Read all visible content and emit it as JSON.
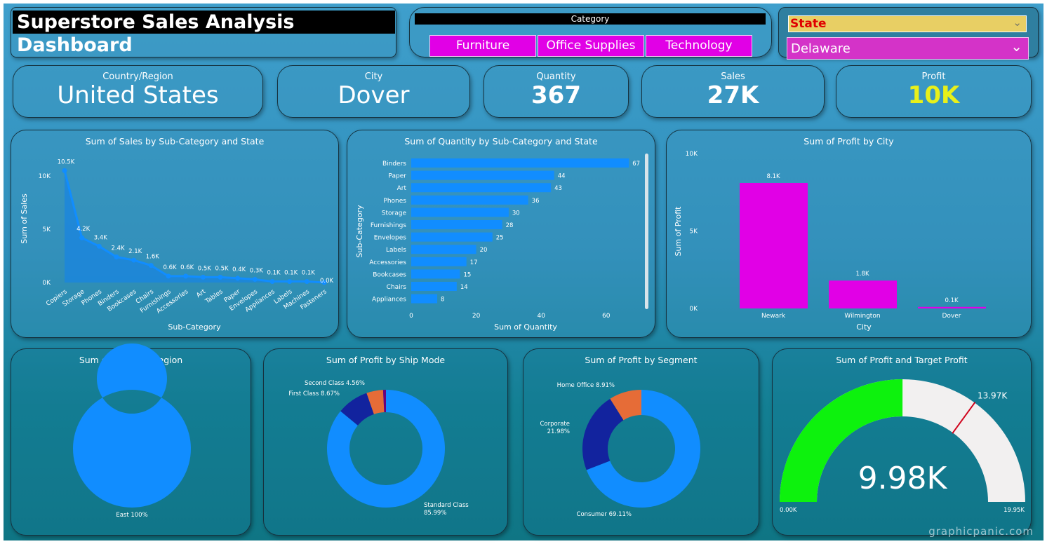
{
  "header": {
    "title": "Superstore Sales Analysis Dashboard"
  },
  "category_slicer": {
    "label": "Category",
    "options": [
      "Furniture",
      "Office Supplies",
      "Technology"
    ]
  },
  "state_slicer": {
    "label": "State",
    "selected": "Delaware"
  },
  "kpis": [
    {
      "label": "Country/Region",
      "value": "United States"
    },
    {
      "label": "City",
      "value": "Dover"
    },
    {
      "label": "Quantity",
      "value": "367"
    },
    {
      "label": "Sales",
      "value": "27K"
    },
    {
      "label": "Profit",
      "value": "10K",
      "color": "#e8f01a"
    }
  ],
  "watermark": "graphicpanic.com",
  "colors": {
    "bar_blue": "#118dff",
    "magenta": "#e100e6",
    "navy": "#12239e",
    "orange": "#e66c37",
    "purple": "#6b007b",
    "gauge_green": "#0df20d",
    "gauge_bg": "#f2f0f0",
    "target": "#d0021b"
  },
  "chart_data": [
    {
      "type": "area",
      "title": "Sum of Sales by Sub-Category and State",
      "xlabel": "Sub-Category",
      "ylabel": "Sum of Sales",
      "ylim": [
        0,
        10
      ],
      "yticks": [
        "0K",
        "5K",
        "10K"
      ],
      "categories": [
        "Copiers",
        "Storage",
        "Phones",
        "Binders",
        "Bookcases",
        "Chairs",
        "Furnishings",
        "Accessories",
        "Art",
        "Tables",
        "Paper",
        "Envelopes",
        "Appliances",
        "Labels",
        "Machines",
        "Fasteners"
      ],
      "values": [
        10.5,
        4.2,
        3.4,
        2.4,
        2.1,
        1.6,
        0.6,
        0.6,
        0.5,
        0.5,
        0.4,
        0.3,
        0.1,
        0.1,
        0.1,
        0.0
      ],
      "labels": [
        "10.5K",
        "4.2K",
        "3.4K",
        "2.4K",
        "2.1K",
        "1.6K",
        "0.6K",
        "0.6K",
        "0.5K",
        "0.5K",
        "0.4K",
        "0.3K",
        "0.1K",
        "0.1K",
        "0.1K",
        "0.0K"
      ]
    },
    {
      "type": "bar",
      "orientation": "horizontal",
      "title": "Sum of Quantity by Sub-Category and State",
      "xlabel": "Sum of Quantity",
      "ylabel": "Sub-Category",
      "xticks": [
        0,
        20,
        40,
        60
      ],
      "categories": [
        "Binders",
        "Paper",
        "Art",
        "Phones",
        "Storage",
        "Furnishings",
        "Envelopes",
        "Labels",
        "Accessories",
        "Bookcases",
        "Chairs",
        "Appliances"
      ],
      "values": [
        67,
        44,
        43,
        36,
        30,
        28,
        25,
        20,
        17,
        15,
        14,
        8
      ]
    },
    {
      "type": "bar",
      "title": "Sum of Profit by City",
      "xlabel": "City",
      "ylabel": "Sum of Profit",
      "yticks": [
        "0K",
        "5K",
        "10K"
      ],
      "ylim": [
        0,
        10
      ],
      "categories": [
        "Newark",
        "Wilmington",
        "Dover"
      ],
      "values": [
        8.1,
        1.8,
        0.1
      ],
      "labels": [
        "8.1K",
        "1.8K",
        "0.1K"
      ]
    },
    {
      "type": "pie",
      "title": "Sum of Sales by Region",
      "slices": [
        {
          "name": "East",
          "value": 100,
          "label": "East 100%"
        }
      ]
    },
    {
      "type": "pie",
      "title": "Sum of Profit by Ship Mode",
      "slices": [
        {
          "name": "Standard Class",
          "value": 85.99,
          "label": "Standard Class 85.99%"
        },
        {
          "name": "First Class",
          "value": 8.67,
          "label": "First Class 8.67%"
        },
        {
          "name": "Second Class",
          "value": 4.56,
          "label": "Second Class 4.56%"
        },
        {
          "name": "",
          "value": 0.78,
          "label": ""
        }
      ]
    },
    {
      "type": "pie",
      "title": "Sum of Profit by Segment",
      "slices": [
        {
          "name": "Consumer",
          "value": 69.11,
          "label": "Consumer 69.11%"
        },
        {
          "name": "Corporate",
          "value": 21.98,
          "label": "Corporate 21.98%"
        },
        {
          "name": "Home Office",
          "value": 8.91,
          "label": "Home Office 8.91%"
        }
      ]
    },
    {
      "type": "gauge",
      "title": "Sum of Profit and Target Profit",
      "value": 9.98,
      "value_label": "9.98K",
      "target": 13.97,
      "target_label": "13.97K",
      "min": 0,
      "min_label": "0.00K",
      "max": 19.95,
      "max_label": "19.95K"
    }
  ]
}
